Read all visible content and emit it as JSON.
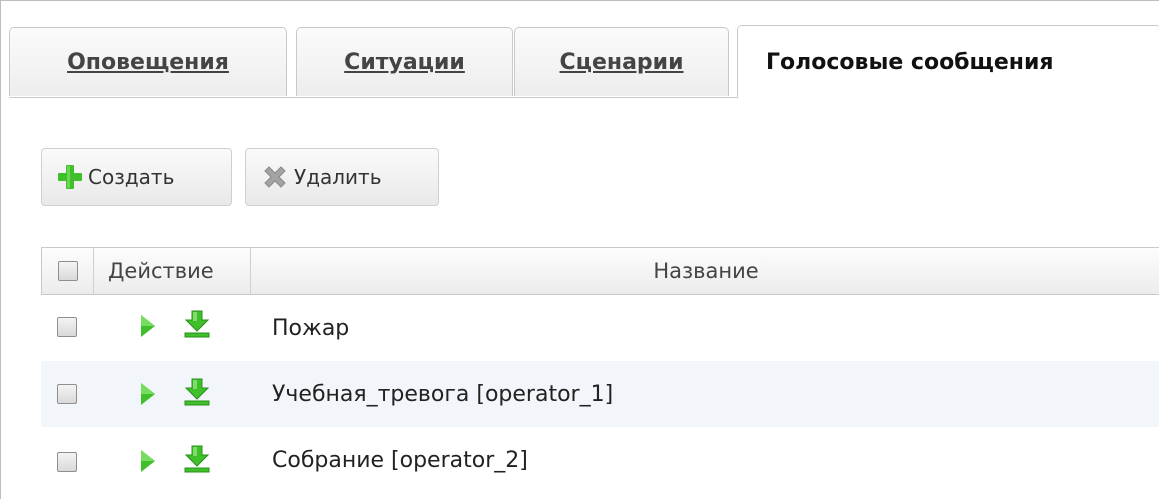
{
  "tabs": [
    {
      "label": "Оповещения",
      "active": false
    },
    {
      "label": "Ситуации",
      "active": false
    },
    {
      "label": "Сценарии",
      "active": false
    },
    {
      "label": "Голосовые сообщения",
      "active": true
    }
  ],
  "toolbar": {
    "create_label": "Создать",
    "delete_label": "Удалить",
    "create_icon": "plus-icon",
    "delete_icon": "cross-icon"
  },
  "grid": {
    "columns": {
      "select": "",
      "action": "Действие",
      "name": "Название"
    },
    "rows": [
      {
        "name": "Пожар",
        "checked": false,
        "actions": [
          "play-icon",
          "download-icon"
        ]
      },
      {
        "name": "Учебная_тревога [operator_1]",
        "checked": false,
        "actions": [
          "play-icon",
          "download-icon"
        ]
      },
      {
        "name": "Собрание [operator_2]",
        "checked": false,
        "actions": [
          "play-icon",
          "download-icon"
        ]
      }
    ]
  },
  "colors": {
    "accent_green": "#3fbf2a",
    "delete_gray": "#9a9a9a",
    "row_alt": "#f2f6fa",
    "border": "#c9c9c9"
  }
}
